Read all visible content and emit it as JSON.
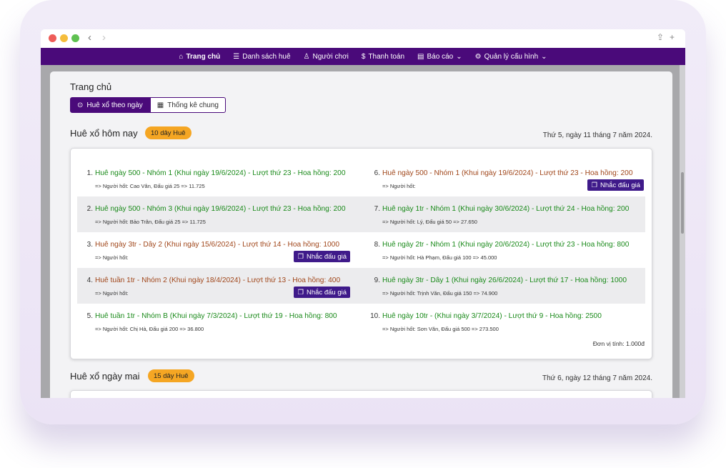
{
  "nav": {
    "items": [
      {
        "icon": "⌂",
        "label": "Trang chủ"
      },
      {
        "icon": "☰",
        "label": "Danh sách huê"
      },
      {
        "icon": "♙",
        "label": "Người chơi"
      },
      {
        "icon": "$",
        "label": "Thanh toán"
      },
      {
        "icon": "▤",
        "label": "Báo cáo"
      },
      {
        "icon": "⚙",
        "label": "Quản lý cấu hình"
      }
    ]
  },
  "page": {
    "title": "Trang chủ",
    "tabs": [
      {
        "icon": "⊙",
        "label": "Huê xổ theo ngày"
      },
      {
        "icon": "▦",
        "label": "Thống kê chung"
      }
    ]
  },
  "today": {
    "title": "Huê xổ hôm nay",
    "badge": "10 dây Huê",
    "date": "Thứ 5, ngày 11 tháng 7 năm 2024.",
    "unit": "Đơn vị tính: 1.000đ",
    "remind_label": "Nhắc đấu giá",
    "left": [
      {
        "num": "1.",
        "title": "Huê ngày 500 - Nhóm 1 (Khui ngày 19/6/2024) - Lượt thứ 23 - Hoa hồng: 200",
        "sub": "=> Người hốt: Cao Vân, Đấu giá 25 => 11.725"
      },
      {
        "num": "2.",
        "title": "Huê ngày 500 - Nhóm 3 (Khui ngày 19/6/2024) - Lượt thứ 23 - Hoa hồng: 200",
        "sub": "=> Người hốt: Bảo Trân, Đấu giá 25 => 11.725"
      },
      {
        "num": "3.",
        "title": "Huê ngày 3tr - Dây 2 (Khui ngày 15/6/2024) - Lượt thứ 14 - Hoa hồng: 1000",
        "sub": "=> Người hốt:"
      },
      {
        "num": "4.",
        "title": "Huê tuần 1tr - Nhóm 2 (Khui ngày 18/4/2024) - Lượt thứ 13 - Hoa hồng: 400",
        "sub": "=> Người hốt:"
      },
      {
        "num": "5.",
        "title": "Huê tuần 1tr - Nhóm B (Khui ngày 7/3/2024) - Lượt thứ 19 - Hoa hồng: 800",
        "sub": "=> Người hốt: Chị Hà, Đấu giá 200 => 36.800"
      }
    ],
    "right": [
      {
        "num": "6.",
        "title": "Huê ngày 500 - Nhóm 1 (Khui ngày 19/6/2024) - Lượt thứ 23 - Hoa hồng: 200",
        "sub": "=> Người hốt:"
      },
      {
        "num": "7.",
        "title": "Huê ngày 1tr - Nhóm 1 (Khui ngày 30/6/2024) - Lượt thứ 24 - Hoa hồng: 200",
        "sub": "=> Người hốt: Lý, Đấu giá 50 => 27.650"
      },
      {
        "num": "8.",
        "title": "Huê ngày 2tr - Nhóm 1 (Khui ngày 20/6/2024) - Lượt thứ 23 - Hoa hồng: 800",
        "sub": "=> Người hốt: Hà Phạm, Đấu giá 100 => 45.000"
      },
      {
        "num": "9.",
        "title": "Huê ngày 3tr - Dây 1 (Khui ngày 26/6/2024) - Lượt thứ 17 - Hoa hồng: 1000",
        "sub": "=> Người hốt: Trịnh Văn, Đấu giá 150 => 74.900"
      },
      {
        "num": "10.",
        "title": "Huê ngày 10tr - (Khui ngày 3/7/2024) - Lượt thứ 9 - Hoa hồng: 2500",
        "sub": "=> Người hốt: Sơn Văn, Đấu giá 500 => 273.500"
      }
    ]
  },
  "tomorrow": {
    "title": "Huê xổ ngày mai",
    "badge": "15 dây Huê",
    "date": "Thứ 6, ngày 12 tháng 7 năm 2024."
  }
}
